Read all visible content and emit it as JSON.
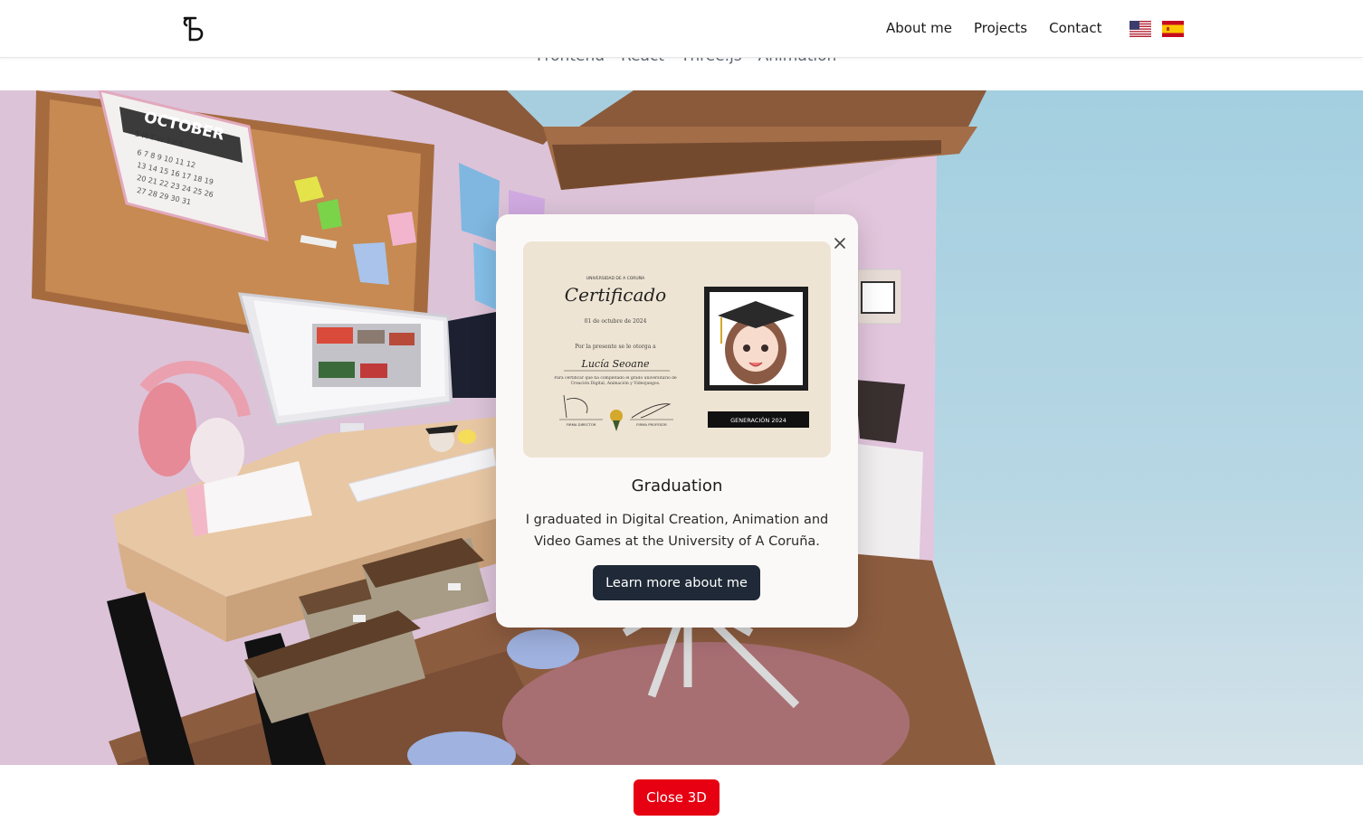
{
  "header": {
    "nav": [
      {
        "label": "About me"
      },
      {
        "label": "Projects"
      },
      {
        "label": "Contact"
      }
    ],
    "languages": [
      "english-flag-icon",
      "spanish-flag-icon"
    ]
  },
  "tags": [
    "Frontend",
    "React",
    "Three.js",
    "Animation"
  ],
  "scene": {
    "calendar_month": "OCTOBER",
    "calendar_days": "S M T W T F S",
    "calendar_numbers": [
      "6 7 8 9 10 11 12",
      "13 14 15 16 17 18 19",
      "20 21 22 23 24 25 26",
      "27 28 29 30 31"
    ]
  },
  "modal": {
    "title": "Graduation",
    "description": "I graduated in Digital Creation, Animation and Video Games at the University of A Coruña.",
    "button_label": "Learn more about me",
    "certificate": {
      "university": "UNIVERSIDAD DE A CORUÑA",
      "heading": "Certificado",
      "date": "01 de octubre de 2024",
      "granted_to": "Por la presente se le otorga a",
      "name": "Lucía Seoane",
      "body": "Para certificar que ha completado el grado universitario de Creación Digital, Animación y Videojuegos.",
      "sign_left": "FIRMA DIRECTOR",
      "sign_right": "FIRMA PROFESOR",
      "generation": "GENERACIÓN 2024"
    }
  },
  "footer": {
    "close3d_label": "Close 3D"
  },
  "colors": {
    "close3d": "#e60012",
    "learn_btn": "#1f2937"
  }
}
